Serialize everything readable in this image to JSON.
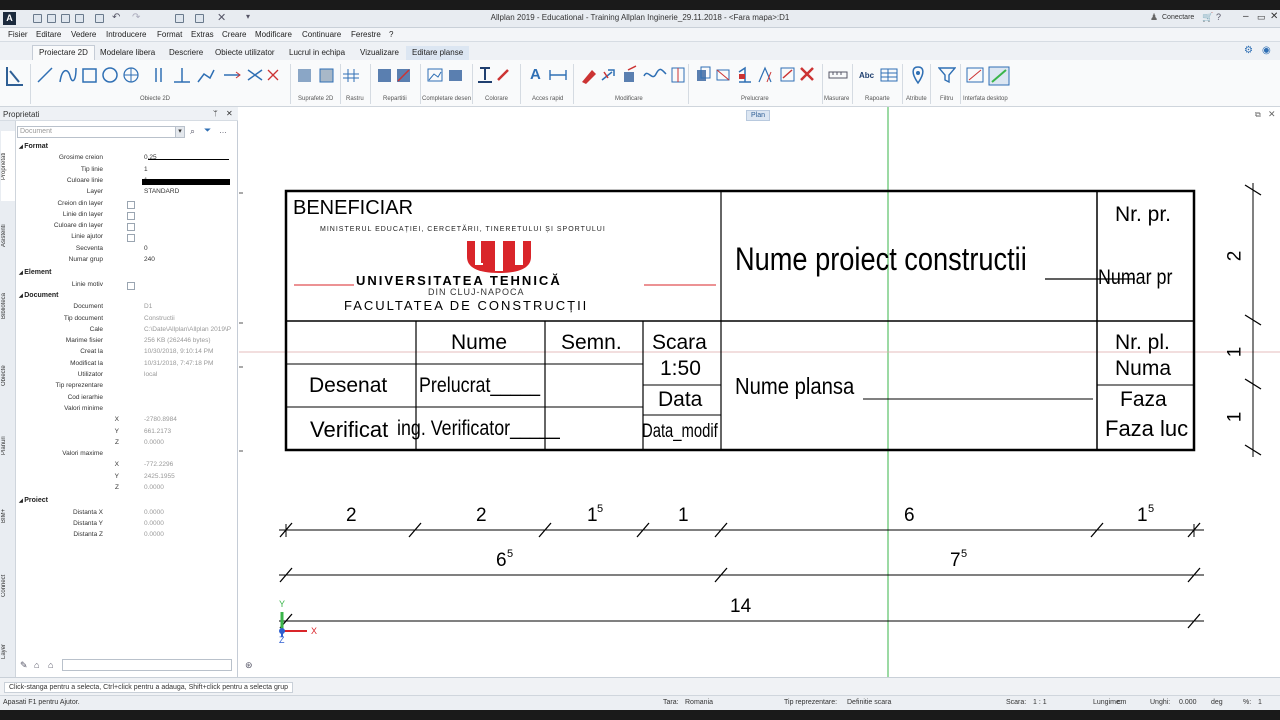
{
  "window": {
    "title": "Allplan 2019 - Educational - Training Allplan Inginerie_29.11.2018 - <Fara mapa>:D1",
    "connect_label": "Conectare"
  },
  "menu": [
    "Fisier",
    "Editare",
    "Vedere",
    "Introducere",
    "Format",
    "Extras",
    "Creare",
    "Modificare",
    "Continuare",
    "Ferestre",
    "?"
  ],
  "tabs": [
    "Proiectare 2D",
    "Modelare libera",
    "Descriere",
    "Obiecte utilizator",
    "Lucrul in echipa",
    "Vizualizare",
    "Editare planse"
  ],
  "ribbon_groups": [
    "Obiecte 2D",
    "Suprafete 2D",
    "Rastru",
    "Repartitii",
    "Completare desen",
    "Colorare",
    "Acces rapid",
    "Modificare",
    "Prelucrare",
    "Masurare",
    "Rapoarte",
    "Atribute",
    "Filtru",
    "Interfata desktop"
  ],
  "properties": {
    "title": "Proprietati",
    "pin": "ᛘ",
    "close": "✕",
    "dropdown": "Document",
    "vertical_tabs": [
      "Proprietati",
      "Asistenti",
      "Biblioteca",
      "Obiecte",
      "Planuri",
      "BIM+",
      "Connect",
      "Layer"
    ],
    "sections": {
      "format": "Format",
      "element": "Element",
      "document": "Document",
      "proiect": "Proiect"
    },
    "format_rows": [
      {
        "label": "Grosime creion",
        "value": "0.25"
      },
      {
        "label": "Tip linie",
        "value": "1"
      },
      {
        "label": "Culoare linie",
        "value": "1"
      },
      {
        "label": "Layer",
        "value": "STANDARD"
      },
      {
        "label": "Creion din layer",
        "value": ""
      },
      {
        "label": "Linie din layer",
        "value": ""
      },
      {
        "label": "Culoare din layer",
        "value": ""
      },
      {
        "label": "Linie ajutor",
        "value": ""
      },
      {
        "label": "Secventa",
        "value": "0"
      },
      {
        "label": "Numar grup",
        "value": "240"
      }
    ],
    "element_rows": [
      {
        "label": "Linie motiv",
        "value": ""
      }
    ],
    "document_rows": [
      {
        "label": "Document",
        "value": "D1"
      },
      {
        "label": "Tip document",
        "value": "Constructii"
      },
      {
        "label": "Cale",
        "value": "C:\\Date\\Allplan\\Allplan 2019\\P"
      },
      {
        "label": "Marime fisier",
        "value": "256 KB (262446 bytes)"
      },
      {
        "label": "Creat la",
        "value": "10/30/2018, 9:10:14 PM"
      },
      {
        "label": "Modificat la",
        "value": "10/31/2018, 7:47:18 PM"
      },
      {
        "label": "Utilizator",
        "value": "local"
      },
      {
        "label": "Tip reprezentare",
        "value": ""
      },
      {
        "label": "Cod ierarhie",
        "value": ""
      },
      {
        "label": "Valori minime",
        "value": ""
      },
      {
        "label": "X",
        "value": "-2780.8984"
      },
      {
        "label": "Y",
        "value": "661.2173"
      },
      {
        "label": "Z",
        "value": "0.0000"
      },
      {
        "label": "Valori maxime",
        "value": ""
      },
      {
        "label": "X",
        "value": "-772.2296"
      },
      {
        "label": "Y",
        "value": "2425.1955"
      },
      {
        "label": "Z",
        "value": "0.0000"
      }
    ],
    "proiect_rows": [
      {
        "label": "Distanta X",
        "value": "0.0000"
      },
      {
        "label": "Distanta Y",
        "value": "0.0000"
      },
      {
        "label": "Distanta Z",
        "value": "0.0000"
      }
    ]
  },
  "canvas": {
    "plan_label": "Plan",
    "cartus": {
      "beneficiar": "BENEFICIAR",
      "ministerul": "MINISTERUL EDUCAȚIEI, CERCETĂRII, TINERETULUI ȘI SPORTULUI",
      "universitate": "UNIVERSITATEA TEHNICĂ",
      "oras": "DIN CLUJ-NAPOCA",
      "facultate": "FACULTATEA DE CONSTRUCȚII",
      "nume_proiect": "Nume proiect constructii",
      "nr_pr_label": "Nr. pr.",
      "numar_pr": "Numar pr",
      "nume_h": "Nume",
      "semn_h": "Semn.",
      "scara_h": "Scara",
      "scara_v": "1:50",
      "data_h": "Data",
      "data_v": "Data_modif",
      "desenat": "Desenat",
      "prelucrat": "Prelucrat_____",
      "verificat": "Verificat",
      "verificator": "ing. Verificator_____",
      "nume_plansa": "Nume plansa",
      "nr_pl_label": "Nr. pl.",
      "numa": "Numa",
      "faza_label": "Faza",
      "faza_luc": "Faza luc"
    },
    "dims_row1": [
      "2",
      "2",
      "1",
      "1",
      "6",
      "1"
    ],
    "dims_row1_sup": [
      "",
      "",
      "5",
      "",
      "",
      "5"
    ],
    "dims_row2": [
      "6",
      "7"
    ],
    "dims_row2_sup": [
      "5",
      "5"
    ],
    "dims_row3": [
      "14"
    ],
    "dims_right": [
      "2",
      "1",
      "1"
    ],
    "axis_x": "X",
    "axis_y": "Y",
    "axis_z": "Z"
  },
  "status": {
    "hint": "Click-stanga pentru a selecta, Ctrl+click pentru a adauga, Shift+click pentru a selecta grup",
    "help": "Apasati F1 pentru Ajutor.",
    "tara_label": "Tara:",
    "tara": "Romania",
    "tip_label": "Tip reprezentare:",
    "tip": "Definitie scara",
    "scara_label": "Scara:",
    "scara": "1 : 1",
    "lungime_label": "Lungime:",
    "lungime": "cm",
    "unghi_label": "Unghi:",
    "unghi": "0.000",
    "unghi_unit": "deg",
    "pct_label": "%:",
    "pct": "1"
  },
  "colors": {
    "accent": "#2f6fb4",
    "logo_red": "#d9252a",
    "guide_green": "#3ab54a",
    "guide_red": "#e05050"
  }
}
